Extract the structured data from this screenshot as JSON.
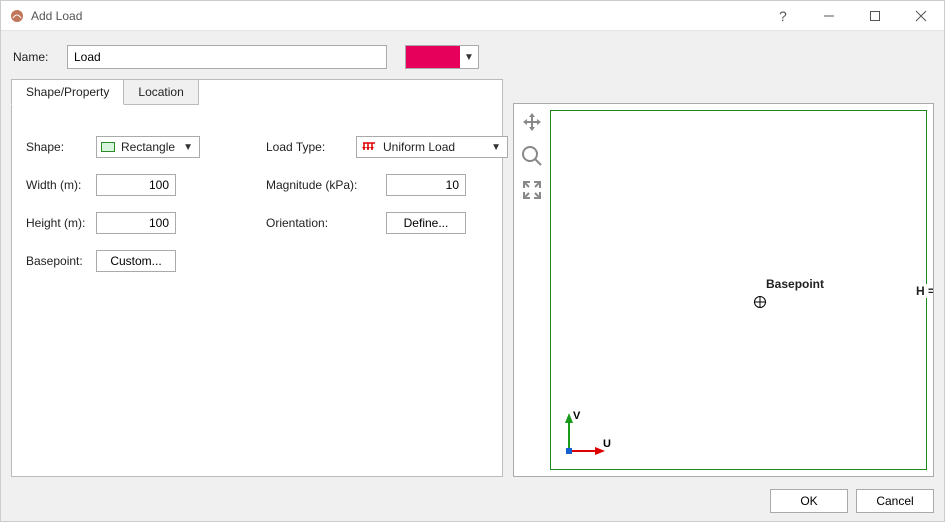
{
  "window": {
    "title": "Add Load"
  },
  "name": {
    "label": "Name:",
    "value": "Load"
  },
  "color": {
    "swatch": "#e6005c"
  },
  "tabs": [
    {
      "label": "Shape/Property",
      "active": true
    },
    {
      "label": "Location",
      "active": false
    }
  ],
  "shape": {
    "label": "Shape:",
    "selected": "Rectangle",
    "width_label": "Width (m):",
    "width_value": "100",
    "height_label": "Height (m):",
    "height_value": "100",
    "basepoint_label": "Basepoint:",
    "basepoint_btn": "Custom..."
  },
  "load": {
    "type_label": "Load Type:",
    "type_selected": "Uniform Load",
    "magnitude_label": "Magnitude (kPa):",
    "magnitude_value": "10",
    "orientation_label": "Orientation:",
    "orientation_btn": "Define..."
  },
  "viewport": {
    "basepoint_text": "Basepoint",
    "h_text": "H =",
    "axis_v": "V",
    "axis_u": "U"
  },
  "footer": {
    "ok": "OK",
    "cancel": "Cancel"
  }
}
